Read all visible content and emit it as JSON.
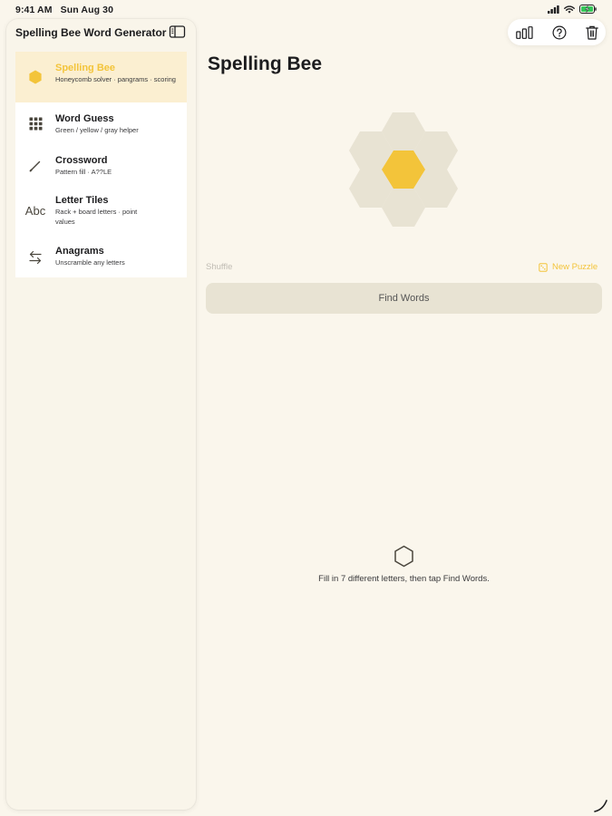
{
  "status_bar": {
    "time": "9:41 AM",
    "date": "Sun Aug 30",
    "icons": [
      "cellular-signal-icon",
      "wifi-icon",
      "battery-charging-icon"
    ]
  },
  "sidebar": {
    "title": "Spelling Bee Word Generator",
    "toggle_icon": "sidebar-toggle-icon",
    "items": [
      {
        "label": "Spelling Bee",
        "subtitle": "Honeycomb solver · pangrams · scoring",
        "icon": "hexagon-icon",
        "selected": true
      },
      {
        "label": "Word Guess",
        "subtitle": "Green / yellow / gray helper",
        "icon": "grid-icon",
        "selected": false
      },
      {
        "label": "Crossword",
        "subtitle": "Pattern fill · A??LE",
        "icon": "pencil-icon",
        "selected": false
      },
      {
        "label": "Letter Tiles",
        "subtitle": "Rack + board letters · point values",
        "icon_text": "Abc",
        "icon": "abc-icon",
        "selected": false
      },
      {
        "label": "Anagrams",
        "subtitle": "Unscramble any letters",
        "icon": "swap-arrows-icon",
        "selected": false
      }
    ]
  },
  "toolbar": {
    "buttons": [
      "stats-icon",
      "help-icon",
      "trash-icon"
    ]
  },
  "main": {
    "title": "Spelling Bee",
    "shuffle_label": "Shuffle",
    "new_puzzle_label": "New Puzzle",
    "find_words_label": "Find Words",
    "empty_message": "Fill in 7 different letters, then tap Find Words."
  },
  "colors": {
    "background": "#faf6ec",
    "accent_yellow": "#f3c43a",
    "selected_row": "#fbefd1",
    "outer_hex": "#e8e3d3",
    "button_fill": "#e8e3d3"
  }
}
